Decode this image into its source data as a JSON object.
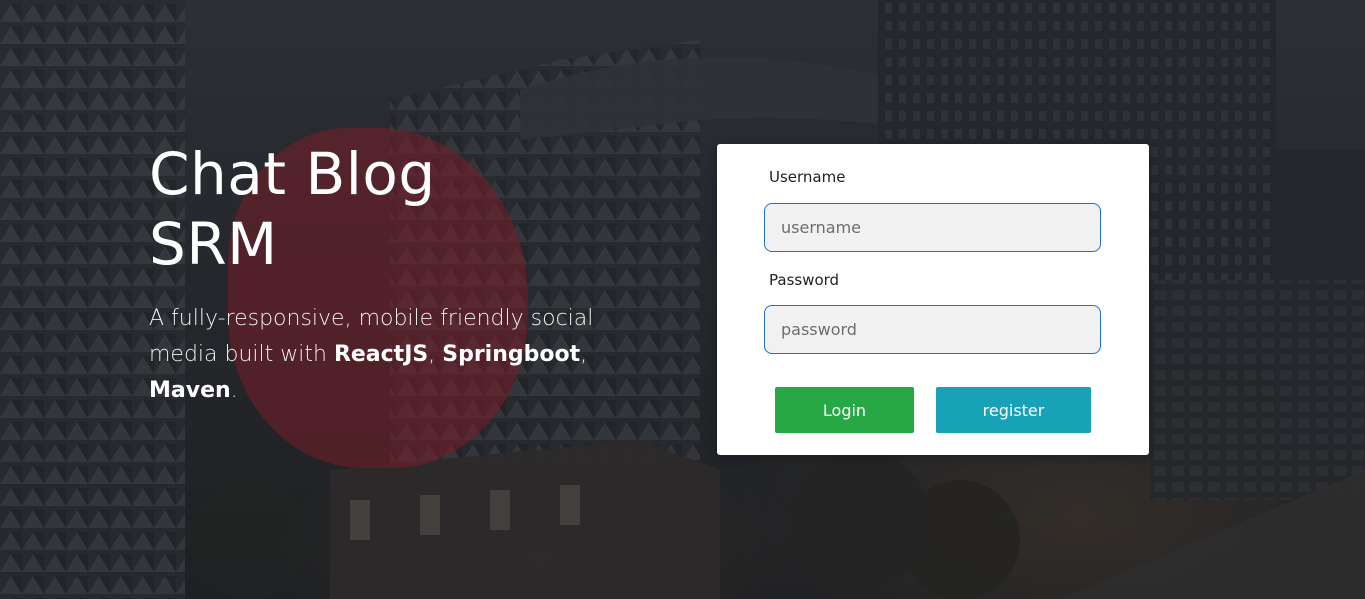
{
  "hero": {
    "title_line1": "Chat Blog",
    "title_line2": "SRM",
    "desc_intro": "A fully-responsive, mobile friendly social media built with ",
    "tech1": "ReactJS",
    "sep1": ", ",
    "tech2": "Springboot",
    "sep2": ", ",
    "tech3": "Maven",
    "desc_end": "."
  },
  "login_form": {
    "username_label": "Username",
    "username_placeholder": "username",
    "username_value": "",
    "password_label": "Password",
    "password_placeholder": "password",
    "password_value": "",
    "login_button": "Login",
    "register_button": "register"
  },
  "colors": {
    "login_button": "#28a745",
    "register_button": "#17a2b8",
    "input_border": "#1a73c8",
    "input_background": "#f1f1f1",
    "card_background": "#ffffff"
  }
}
